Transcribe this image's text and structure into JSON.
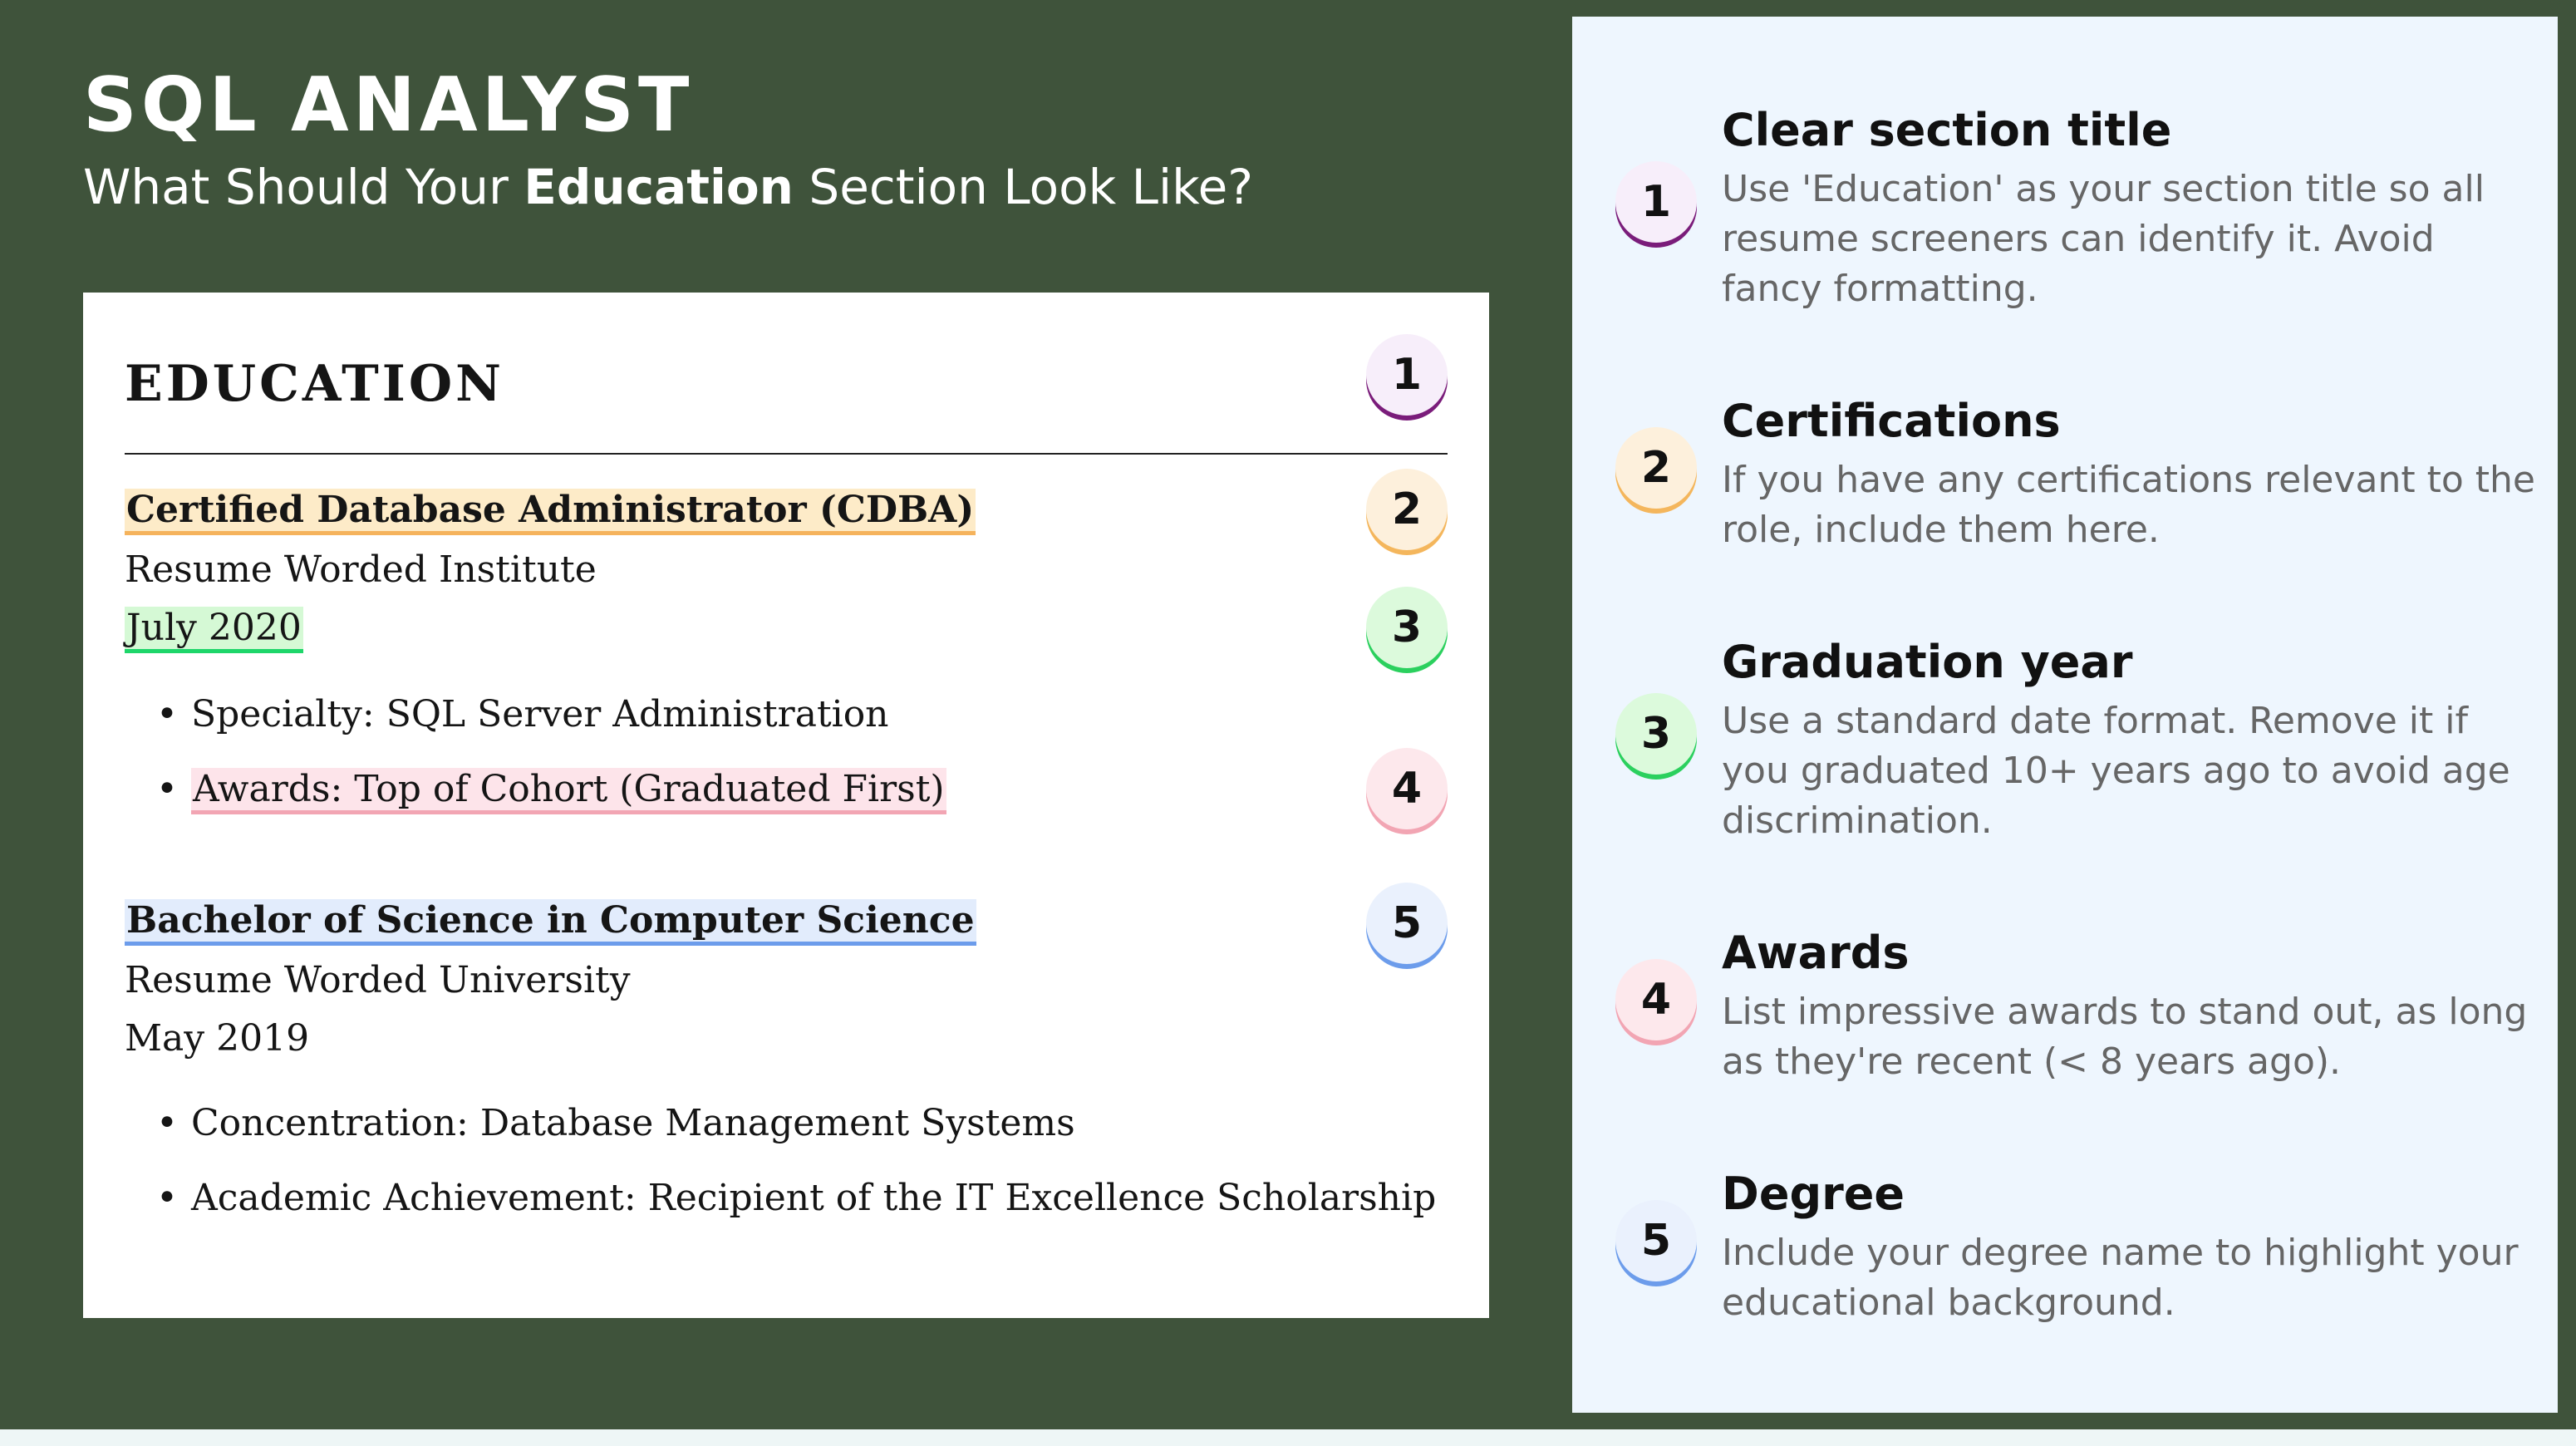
{
  "header": {
    "title": "SQL ANALYST",
    "subtitle_before": "What Should Your ",
    "subtitle_bold": "Education",
    "subtitle_after": " Section Look Like?"
  },
  "resume": {
    "heading": "EDUCATION",
    "entries": [
      {
        "degree": "Certified Database Administrator (CDBA)",
        "institution": "Resume Worded Institute",
        "date": "July 2020",
        "bullets": [
          "Specialty: SQL Server Administration",
          "Awards: Top of Cohort (Graduated First)"
        ]
      },
      {
        "degree": "Bachelor of Science in Computer Science",
        "institution": "Resume Worded University",
        "date": "May 2019",
        "bullets": [
          "Concentration: Database Management Systems",
          "Academic Achievement: Recipient of the IT Excellence Scholarship"
        ]
      }
    ]
  },
  "badges": [
    "1",
    "2",
    "3",
    "4",
    "5"
  ],
  "tips": [
    {
      "number": "1",
      "title": "Clear section title",
      "description": "Use 'Education' as your section title so all resume screeners can identify it. Avoid fancy formatting."
    },
    {
      "number": "2",
      "title": "Certifications",
      "description": "If you have any certifications relevant to the role, include them here."
    },
    {
      "number": "3",
      "title": "Graduation year",
      "description": "Use a standard date format. Remove it if you graduated 10+ years ago to avoid age discrimination."
    },
    {
      "number": "4",
      "title": "Awards",
      "description": "List impressive awards to stand out, as long as they're recent (< 8 years ago)."
    },
    {
      "number": "5",
      "title": "Degree",
      "description": "Include your degree name to highlight your educational background."
    }
  ],
  "colors": {
    "background": "#3f533b",
    "panel": "#eef6fe",
    "badge1": "#7a1c7a",
    "badge2": "#f4b65c",
    "badge3": "#2bd05e",
    "badge4": "#f2a5b3",
    "badge5": "#6c9ceb"
  }
}
